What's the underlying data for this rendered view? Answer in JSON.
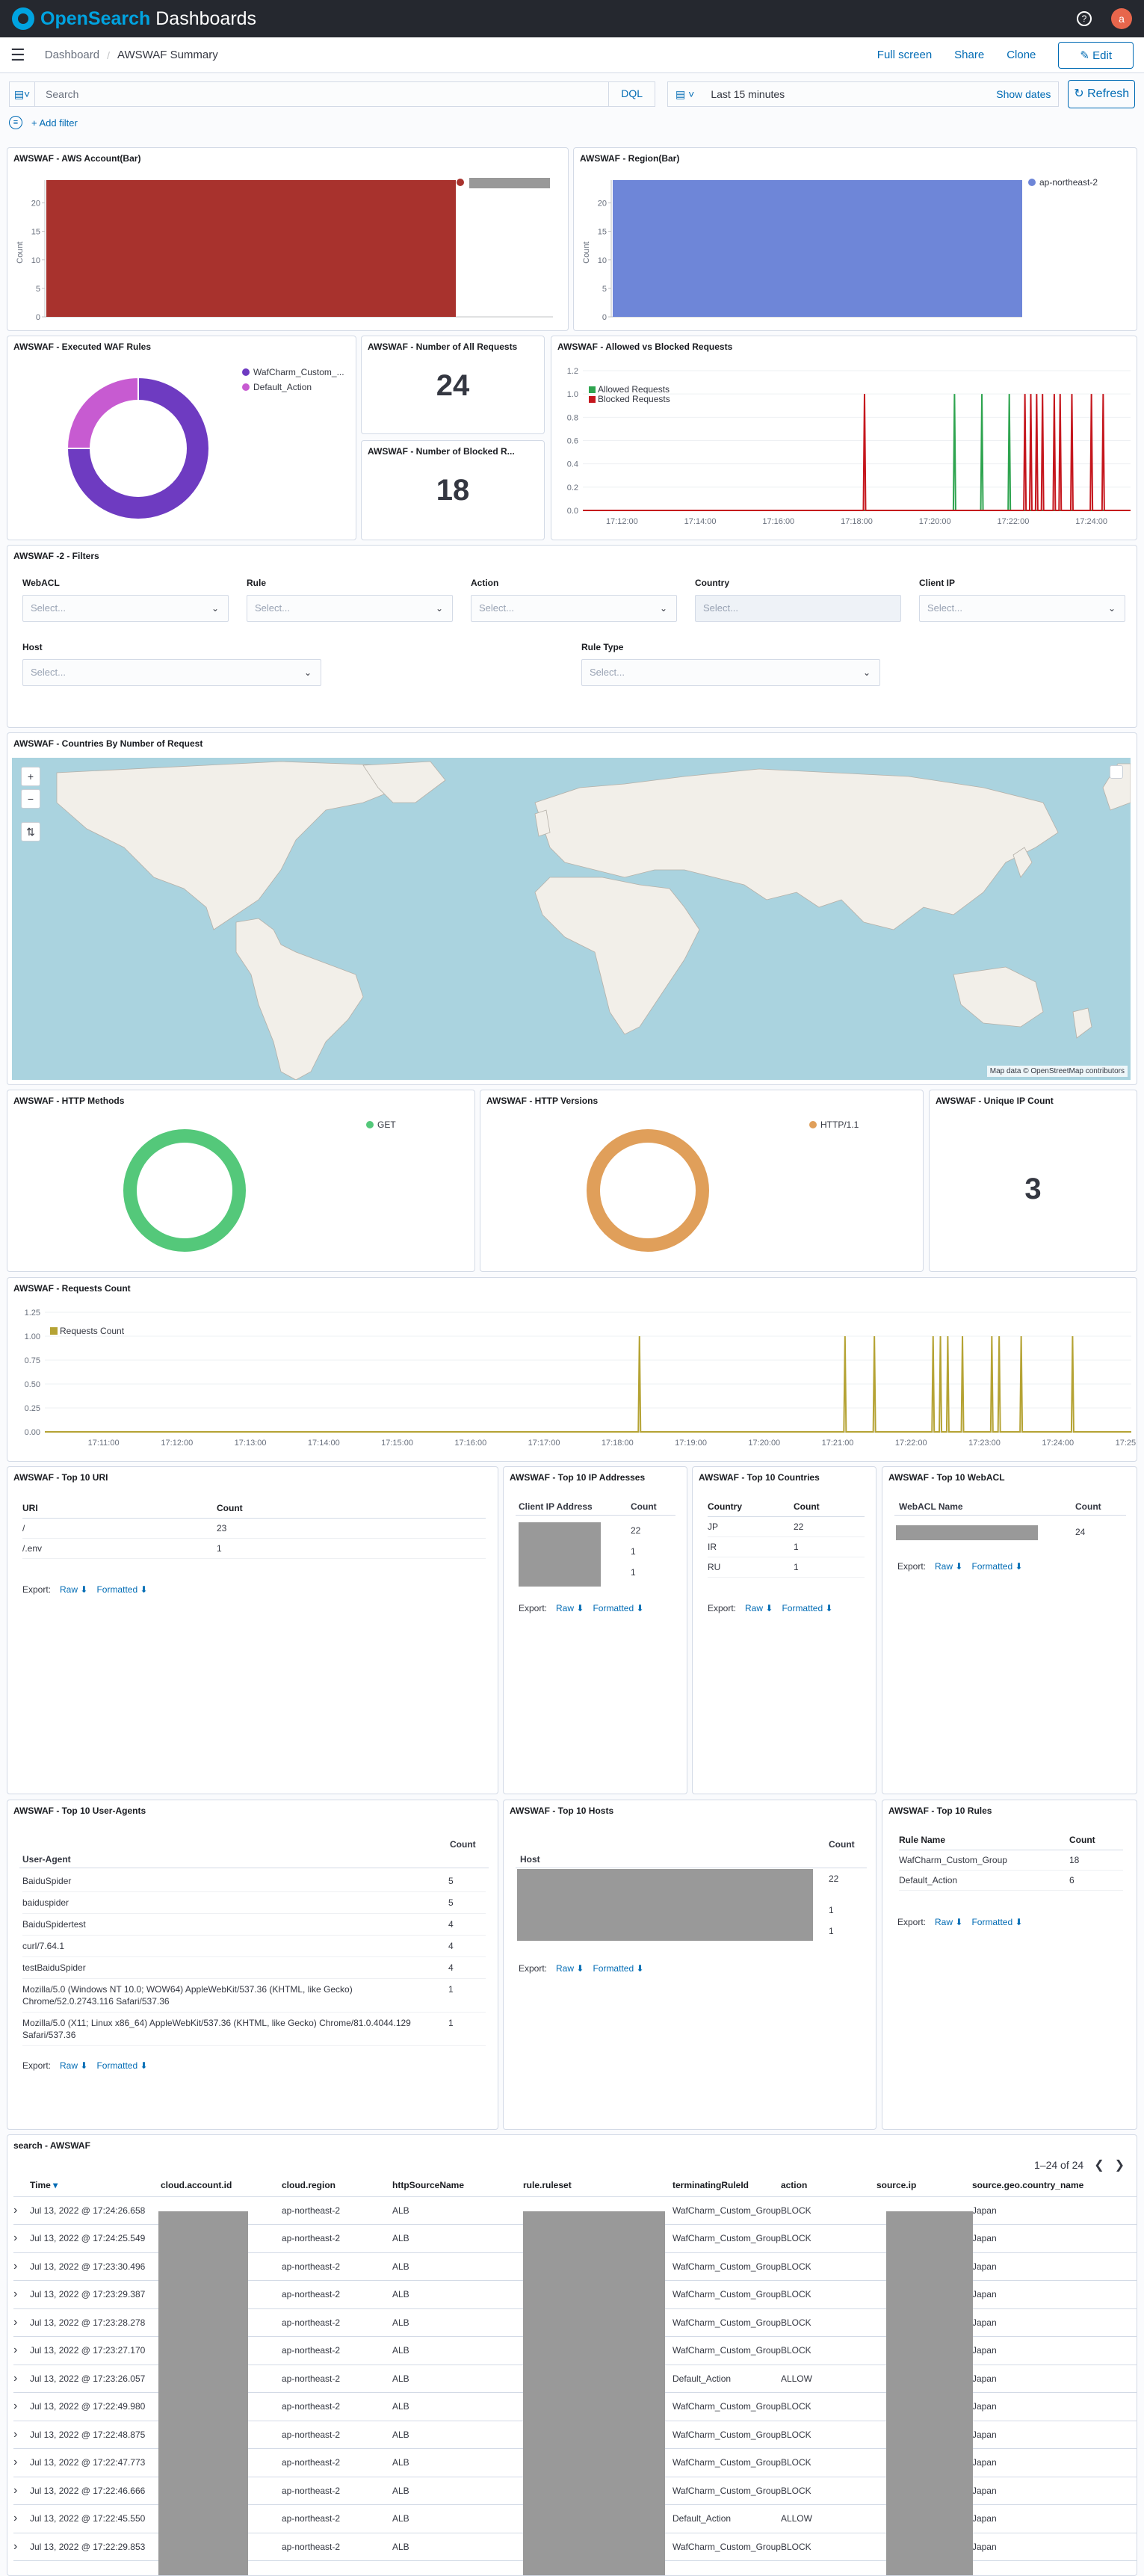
{
  "app": {
    "brand_a": "Open",
    "brand_b": "Search",
    "brand_c": " Dashboards",
    "avatar": "a"
  },
  "breadcrumb": {
    "root": "Dashboard",
    "current": "AWSWAF Summary"
  },
  "header_actions": {
    "fullscreen": "Full screen",
    "share": "Share",
    "clone": "Clone",
    "edit": "Edit"
  },
  "query": {
    "placeholder": "Search",
    "language": "DQL",
    "time": "Last 15 minutes",
    "show_dates": "Show dates",
    "refresh": "Refresh"
  },
  "filters": {
    "add": "+ Add filter"
  },
  "panels": {
    "account": {
      "title": "AWSWAF - AWS Account(Bar)",
      "ylabel": "Count",
      "yticks": [
        "0",
        "5",
        "10",
        "15",
        "20"
      ],
      "color": "#a8322d"
    },
    "region": {
      "title": "AWSWAF - Region(Bar)",
      "ylabel": "Count",
      "yticks": [
        "0",
        "5",
        "10",
        "15",
        "20"
      ],
      "legend": "ap-northeast-2",
      "color": "#6e86d8"
    },
    "rules": {
      "title": "AWSWAF - Executed WAF Rules",
      "legend": [
        "WafCharm_Custom_...",
        "Default_Action"
      ],
      "colors": [
        "#6e3bc1",
        "#c75bd1"
      ]
    },
    "all_requests": {
      "title": "AWSWAF - Number of All Requests",
      "value": "24"
    },
    "blocked_requests": {
      "title": "AWSWAF - Number of Blocked R...",
      "value": "18"
    },
    "allowed_blocked": {
      "title": "AWSWAF - Allowed vs Blocked Requests",
      "legend": [
        "Allowed Requests",
        "Blocked Requests"
      ],
      "colors": [
        "#2ea44f",
        "#c5161d"
      ]
    },
    "filters_panel": {
      "title": "AWSWAF -2 - Filters",
      "labels": [
        "WebACL",
        "Rule",
        "Action",
        "Country",
        "Client IP",
        "Host",
        "Rule Type"
      ],
      "placeholder": "Select..."
    },
    "countries_map": {
      "title": "AWSWAF - Countries By Number of Request",
      "attribution": "Map data © OpenStreetMap contributors"
    },
    "http_methods": {
      "title": "AWSWAF - HTTP Methods",
      "legend": "GET",
      "color": "#54c87a"
    },
    "http_versions": {
      "title": "AWSWAF - HTTP Versions",
      "legend": "HTTP/1.1",
      "color": "#e09f5a"
    },
    "unique_ip": {
      "title": "AWSWAF - Unique IP Count",
      "value": "3"
    },
    "requests_count": {
      "title": "AWSWAF - Requests Count",
      "legend": "Requests Count",
      "color": "#b5a334"
    },
    "top_uri": {
      "title": "AWSWAF - Top 10 URI",
      "headers": [
        "URI",
        "Count"
      ],
      "rows": [
        [
          "/",
          "23"
        ],
        [
          "/.env",
          "1"
        ]
      ]
    },
    "top_ip": {
      "title": "AWSWAF - Top 10 IP Addresses",
      "headers": [
        "Client IP Address",
        "Count"
      ],
      "counts": [
        "22",
        "1",
        "1"
      ]
    },
    "top_countries": {
      "title": "AWSWAF - Top 10 Countries",
      "headers": [
        "Country",
        "Count"
      ],
      "rows": [
        [
          "JP",
          "22"
        ],
        [
          "IR",
          "1"
        ],
        [
          "RU",
          "1"
        ]
      ]
    },
    "top_webacl": {
      "title": "AWSWAF - Top 10 WebACL",
      "headers": [
        "WebACL Name",
        "Count"
      ],
      "counts": [
        "24"
      ]
    },
    "top_agents": {
      "title": "AWSWAF - Top 10 User-Agents",
      "headers": [
        "User-Agent",
        "Count"
      ],
      "rows": [
        [
          "BaiduSpider",
          "5"
        ],
        [
          "baiduspider",
          "5"
        ],
        [
          "BaiduSpidertest",
          "4"
        ],
        [
          "curl/7.64.1",
          "4"
        ],
        [
          "testBaiduSpider",
          "4"
        ],
        [
          "Mozilla/5.0 (Windows NT 10.0; WOW64) AppleWebKit/537.36 (KHTML, like Gecko) Chrome/52.0.2743.116 Safari/537.36",
          "1"
        ],
        [
          "Mozilla/5.0 (X11; Linux x86_64) AppleWebKit/537.36 (KHTML, like Gecko) Chrome/81.0.4044.129 Safari/537.36",
          "1"
        ]
      ]
    },
    "top_hosts": {
      "title": "AWSWAF - Top 10 Hosts",
      "headers": [
        "Host",
        "Count"
      ],
      "counts": [
        "22",
        "1",
        "1"
      ]
    },
    "top_rules": {
      "title": "AWSWAF - Top 10 Rules",
      "headers": [
        "Rule Name",
        "Count"
      ],
      "rows": [
        [
          "WafCharm_Custom_Group",
          "18"
        ],
        [
          "Default_Action",
          "6"
        ]
      ]
    },
    "export": {
      "label": "Export:",
      "raw": "Raw",
      "formatted": "Formatted"
    }
  },
  "chart_data": [
    {
      "type": "bar",
      "title": "AWSWAF - AWS Account(Bar)",
      "ylabel": "Count",
      "categories": [
        ""
      ],
      "values": [
        24
      ],
      "ylim": [
        0,
        24
      ]
    },
    {
      "type": "bar",
      "title": "AWSWAF - Region(Bar)",
      "ylabel": "Count",
      "categories": [
        "ap-northeast-2"
      ],
      "values": [
        24
      ],
      "ylim": [
        0,
        24
      ]
    },
    {
      "type": "pie",
      "title": "AWSWAF - Executed WAF Rules",
      "labels": [
        "WafCharm_Custom_...",
        "Default_Action"
      ],
      "values": [
        18,
        6
      ]
    },
    {
      "type": "line",
      "title": "AWSWAF - Allowed vs Blocked Requests",
      "xlabels": [
        "17:12:00",
        "17:14:00",
        "17:16:00",
        "17:18:00",
        "17:20:00",
        "17:22:00",
        "17:24:00"
      ],
      "yticks": [
        "0.0",
        "0.2",
        "0.4",
        "0.6",
        "0.8",
        "1.0",
        "1.2"
      ],
      "series": [
        {
          "name": "Allowed Requests",
          "spikes_min": [
            20.5,
            21.2,
            21.9
          ]
        },
        {
          "name": "Blocked Requests",
          "spikes_min": [
            18.2,
            22.3,
            22.45,
            22.6,
            22.75,
            23.05,
            23.2,
            23.5,
            24.0,
            24.3
          ]
        }
      ]
    },
    {
      "type": "pie",
      "title": "AWSWAF - HTTP Methods",
      "labels": [
        "GET"
      ],
      "values": [
        24
      ]
    },
    {
      "type": "pie",
      "title": "AWSWAF - HTTP Versions",
      "labels": [
        "HTTP/1.1"
      ],
      "values": [
        24
      ]
    },
    {
      "type": "line",
      "title": "AWSWAF - Requests Count",
      "xlabels": [
        "17:11:00",
        "17:12:00",
        "17:13:00",
        "17:14:00",
        "17:15:00",
        "17:16:00",
        "17:17:00",
        "17:18:00",
        "17:19:00",
        "17:20:00",
        "17:21:00",
        "17:22:00",
        "17:23:00",
        "17:24:00",
        "17:25:00"
      ],
      "yticks": [
        "0.00",
        "0.25",
        "0.50",
        "0.75",
        "1.00",
        "1.25"
      ],
      "series": [
        {
          "name": "Requests Count",
          "spikes_min": [
            18.3,
            21.1,
            21.5,
            22.3,
            22.4,
            22.5,
            22.7,
            23.1,
            23.2,
            23.5,
            24.2
          ]
        }
      ]
    }
  ],
  "search_table": {
    "title": "search - AWSWAF",
    "pagination": "1–24 of 24",
    "columns": [
      "Time",
      "cloud.account.id",
      "cloud.region",
      "httpSourceName",
      "rule.ruleset",
      "terminatingRuleId",
      "action",
      "source.ip",
      "source.geo.country_name"
    ],
    "rows": [
      [
        "Jul 13, 2022 @ 17:24:26.658",
        "ap-northeast-2",
        "ALB",
        "WafCharm_Custom_Group",
        "BLOCK",
        "Japan"
      ],
      [
        "Jul 13, 2022 @ 17:24:25.549",
        "ap-northeast-2",
        "ALB",
        "WafCharm_Custom_Group",
        "BLOCK",
        "Japan"
      ],
      [
        "Jul 13, 2022 @ 17:23:30.496",
        "ap-northeast-2",
        "ALB",
        "WafCharm_Custom_Group",
        "BLOCK",
        "Japan"
      ],
      [
        "Jul 13, 2022 @ 17:23:29.387",
        "ap-northeast-2",
        "ALB",
        "WafCharm_Custom_Group",
        "BLOCK",
        "Japan"
      ],
      [
        "Jul 13, 2022 @ 17:23:28.278",
        "ap-northeast-2",
        "ALB",
        "WafCharm_Custom_Group",
        "BLOCK",
        "Japan"
      ],
      [
        "Jul 13, 2022 @ 17:23:27.170",
        "ap-northeast-2",
        "ALB",
        "WafCharm_Custom_Group",
        "BLOCK",
        "Japan"
      ],
      [
        "Jul 13, 2022 @ 17:23:26.057",
        "ap-northeast-2",
        "ALB",
        "Default_Action",
        "ALLOW",
        "Japan"
      ],
      [
        "Jul 13, 2022 @ 17:22:49.980",
        "ap-northeast-2",
        "ALB",
        "WafCharm_Custom_Group",
        "BLOCK",
        "Japan"
      ],
      [
        "Jul 13, 2022 @ 17:22:48.875",
        "ap-northeast-2",
        "ALB",
        "WafCharm_Custom_Group",
        "BLOCK",
        "Japan"
      ],
      [
        "Jul 13, 2022 @ 17:22:47.773",
        "ap-northeast-2",
        "ALB",
        "WafCharm_Custom_Group",
        "BLOCK",
        "Japan"
      ],
      [
        "Jul 13, 2022 @ 17:22:46.666",
        "ap-northeast-2",
        "ALB",
        "WafCharm_Custom_Group",
        "BLOCK",
        "Japan"
      ],
      [
        "Jul 13, 2022 @ 17:22:45.550",
        "ap-northeast-2",
        "ALB",
        "Default_Action",
        "ALLOW",
        "Japan"
      ],
      [
        "Jul 13, 2022 @ 17:22:29.853",
        "ap-northeast-2",
        "ALB",
        "WafCharm_Custom_Group",
        "BLOCK",
        "Japan"
      ]
    ]
  }
}
